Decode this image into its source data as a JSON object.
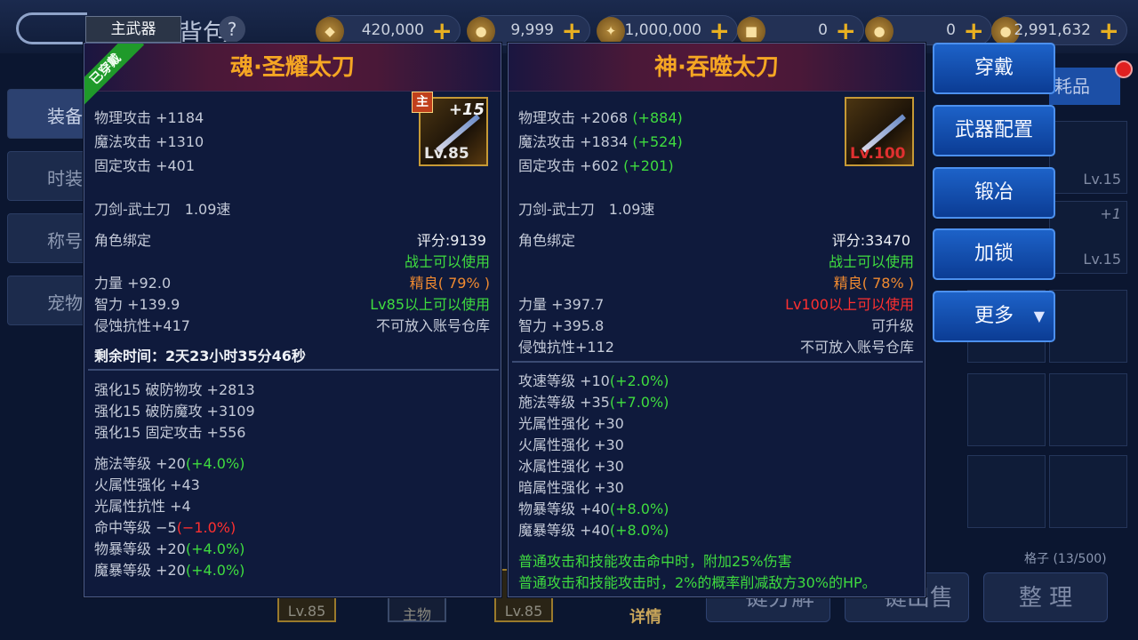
{
  "header": {
    "title_partial": "背包",
    "currencies": [
      {
        "icon": "crystal-icon",
        "value": "420,000"
      },
      {
        "icon": "coin-icon",
        "value": "9,999"
      },
      {
        "icon": "ticket-icon",
        "value": "1,000,000"
      },
      {
        "icon": "scroll-icon",
        "value": "0"
      },
      {
        "icon": "medal-icon",
        "value": "0"
      },
      {
        "icon": "gold-icon",
        "value": "2,991,632"
      }
    ]
  },
  "left_tabs": [
    "装备",
    "时装",
    "称号",
    "宠物"
  ],
  "background": {
    "consumables_tab": "耗品",
    "slot_levels": [
      "Lv.15",
      "Lv.15"
    ],
    "slot_plus": "+1",
    "grid_count": "格子 (13/500)",
    "bottom_buttons": [
      "一键分解",
      "一键出售",
      "整 理"
    ],
    "detail": "详情",
    "bottom_items": [
      "Lv.85",
      "主物",
      "Lv.85"
    ]
  },
  "left_panel": {
    "weapon_label": "主武器",
    "equipped_ribbon": "已穿戴",
    "title": "魂·圣耀太刀",
    "icon": {
      "level": "Lv.85",
      "enhance": "+15",
      "main_tag": "主"
    },
    "attacks": [
      {
        "text": "物理攻击 +1184",
        "diff": ""
      },
      {
        "text": "魔法攻击 +1310",
        "diff": ""
      },
      {
        "text": "固定攻击 +401",
        "diff": ""
      }
    ],
    "type_line": "刀剑-武士刀　1.09速",
    "bind": "角色绑定",
    "score": "评分:9139",
    "class_req": "战士可以使用",
    "quality": "精良( 79% )",
    "stats": [
      {
        "left": "力量 +92.0",
        "right": ""
      },
      {
        "left": "智力 +139.9",
        "right": "Lv85以上可以使用"
      },
      {
        "left": "侵蚀抗性+417",
        "right": "不可放入账号仓库"
      }
    ],
    "remaining": "剩余时间：2天23小时35分46秒",
    "enhance_lines": [
      "强化15 破防物攻 +2813",
      "强化15 破防魔攻 +3109",
      "强化15 固定攻击 +556"
    ],
    "extra_lines": [
      {
        "text": "施法等级 +20",
        "pct": "(+4.0%)",
        "color": "g"
      },
      {
        "text": "火属性强化 +43",
        "pct": "",
        "color": ""
      },
      {
        "text": "光属性抗性 +4",
        "pct": "",
        "color": ""
      },
      {
        "text": "命中等级 −5",
        "pct": "(−1.0%)",
        "color": "r"
      },
      {
        "text": "物暴等级 +20",
        "pct": "(+4.0%)",
        "color": "g"
      },
      {
        "text": "魔暴等级 +20",
        "pct": "(+4.0%)",
        "color": "g"
      }
    ]
  },
  "right_panel": {
    "title": "神·吞噬太刀",
    "icon": {
      "level": "Lv.100"
    },
    "attacks": [
      {
        "text": "物理攻击 +2068",
        "diff": "(+884)"
      },
      {
        "text": "魔法攻击 +1834",
        "diff": "(+524)"
      },
      {
        "text": "固定攻击 +602",
        "diff": "(+201)"
      }
    ],
    "type_line": "刀剑-武士刀　1.09速",
    "bind": "角色绑定",
    "score": "评分:33470",
    "class_req": "战士可以使用",
    "quality": "精良( 78% )",
    "stats": [
      {
        "left": "力量 +397.7",
        "right": "Lv100以上可以使用"
      },
      {
        "left": "智力 +395.8",
        "right": "可升级"
      },
      {
        "left": "侵蚀抗性+112",
        "right": "不可放入账号仓库"
      }
    ],
    "extra_lines": [
      {
        "text": "攻速等级 +10",
        "pct": "(+2.0%)",
        "color": "g"
      },
      {
        "text": "施法等级 +35",
        "pct": "(+7.0%)",
        "color": "g"
      },
      {
        "text": "光属性强化 +30",
        "pct": "",
        "color": ""
      },
      {
        "text": "火属性强化 +30",
        "pct": "",
        "color": ""
      },
      {
        "text": "冰属性强化 +30",
        "pct": "",
        "color": ""
      },
      {
        "text": "暗属性强化 +30",
        "pct": "",
        "color": ""
      },
      {
        "text": "物暴等级 +40",
        "pct": "(+8.0%)",
        "color": "g"
      },
      {
        "text": "魔暴等级 +40",
        "pct": "(+8.0%)",
        "color": "g"
      }
    ],
    "special_lines": [
      "普通攻击和技能攻击命中时，附加25%伤害",
      "普通攻击和技能攻击时，2%的概率削减敌方30%的HP。"
    ]
  },
  "actions": {
    "equip": "穿戴",
    "weapon_config": "武器配置",
    "forge": "锻冶",
    "lock": "加锁",
    "more": "更多"
  },
  "colors": {
    "title_gold": "#f5a623",
    "stat_green": "#3fdc3f",
    "stat_red": "#ff3030",
    "quality_orange": "#f08a30",
    "button_blue": "#1d62c8"
  }
}
